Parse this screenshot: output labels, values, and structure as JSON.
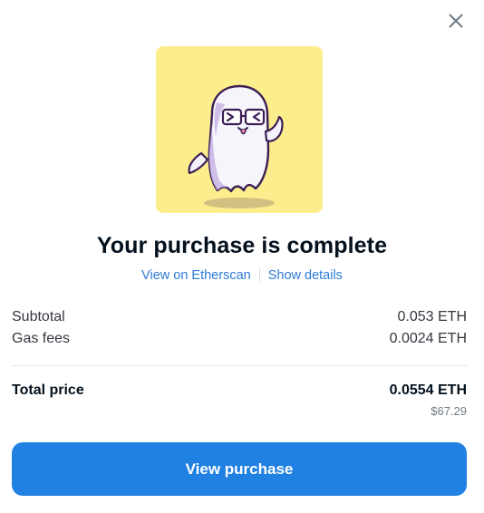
{
  "icons": {
    "close": "close-icon",
    "art": "ghost-illustration"
  },
  "colors": {
    "art_background": "#fcee8d",
    "link": "#2e7ad7",
    "primary_button": "#2081e2"
  },
  "modal": {
    "title": "Your purchase is complete",
    "links": {
      "etherscan": "View on Etherscan",
      "details": "Show details"
    },
    "summary": {
      "subtotal_label": "Subtotal",
      "subtotal_value": "0.053 ETH",
      "gas_label": "Gas fees",
      "gas_value": "0.0024 ETH",
      "total_label": "Total price",
      "total_value": "0.0554 ETH",
      "total_usd": "$67.29"
    },
    "cta_label": "View purchase"
  }
}
